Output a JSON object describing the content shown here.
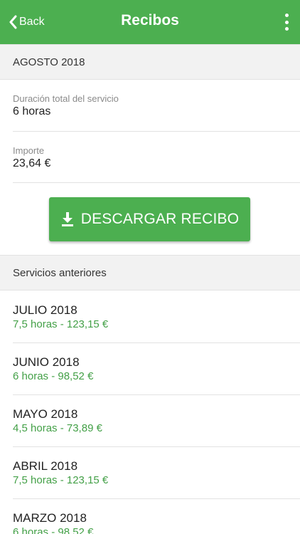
{
  "header": {
    "back_label": "Back",
    "title": "Recibos"
  },
  "current": {
    "month": "AGOSTO 2018",
    "duration_label": "Duración total del servicio",
    "duration_value": "6 horas",
    "amount_label": "Importe",
    "amount_value": "23,64 €"
  },
  "download_button": {
    "label": "DESCARGAR RECIBO",
    "icon": "download-icon"
  },
  "previous": {
    "title": "Servicios anteriores",
    "items": [
      {
        "month": "JULIO 2018",
        "detail": "7,5 horas - 123,15 €"
      },
      {
        "month": "JUNIO 2018",
        "detail": "6 horas - 98,52 €"
      },
      {
        "month": "MAYO 2018",
        "detail": "4,5 horas - 73,89 €"
      },
      {
        "month": "ABRIL 2018",
        "detail": "7,5 horas - 123,15 €"
      },
      {
        "month": "MARZO 2018",
        "detail": "6 horas - 98,52 €"
      }
    ]
  },
  "colors": {
    "primary": "#4caf50",
    "accent_text": "#43a047",
    "section_bg": "#f2f2f2"
  }
}
